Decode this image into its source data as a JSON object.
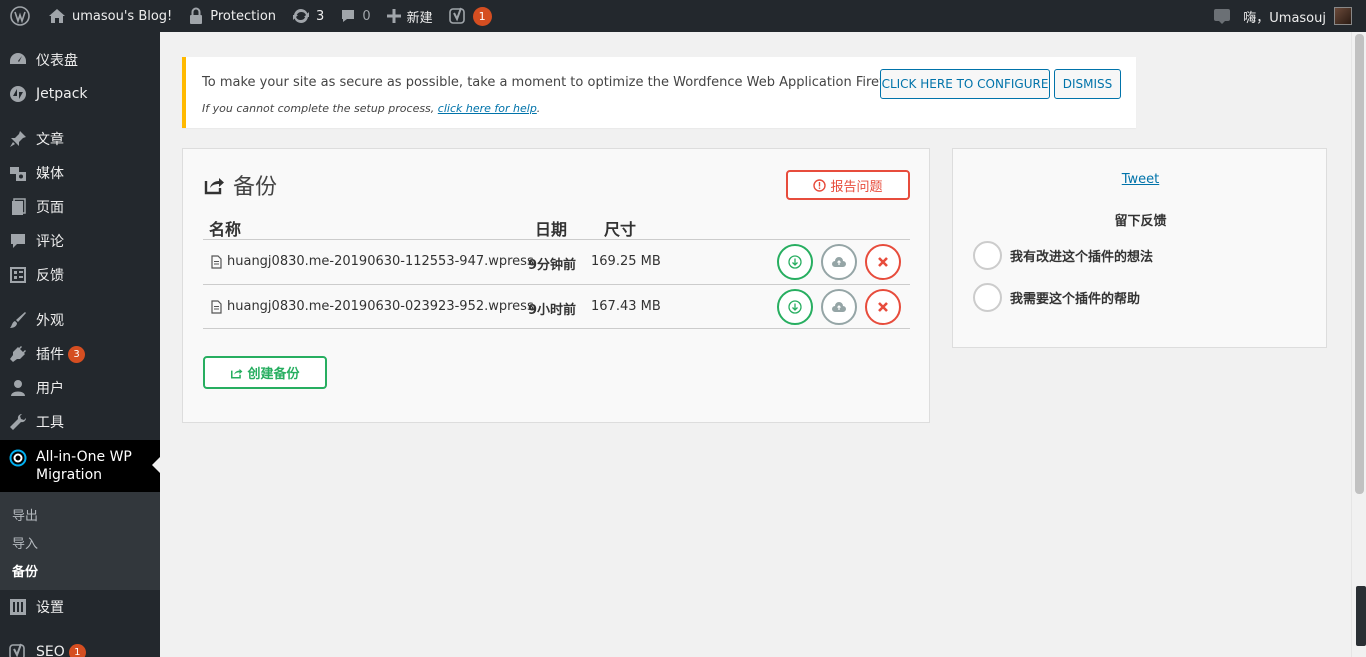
{
  "adminbar": {
    "site_name": "umasou's Blog!",
    "protection": "Protection",
    "updates_count": "3",
    "comments_count": "0",
    "new_label": "新建",
    "yoast_badge": "1",
    "greeting": "嗨，Umasouj"
  },
  "sidebar": {
    "items": [
      {
        "label": "仪表盘",
        "icon": "dashboard-icon"
      },
      {
        "label": "Jetpack",
        "icon": "jetpack-icon"
      },
      {
        "label": "文章",
        "icon": "pin-icon"
      },
      {
        "label": "媒体",
        "icon": "media-icon"
      },
      {
        "label": "页面",
        "icon": "page-icon"
      },
      {
        "label": "评论",
        "icon": "comment-icon"
      },
      {
        "label": "反馈",
        "icon": "feedback-icon"
      },
      {
        "label": "外观",
        "icon": "brush-icon"
      },
      {
        "label": "插件",
        "icon": "plugin-icon",
        "badge": "3"
      },
      {
        "label": "用户",
        "icon": "user-icon"
      },
      {
        "label": "工具",
        "icon": "wrench-icon"
      }
    ],
    "current": {
      "label": "All-in-One WP Migration",
      "icon": "migration-icon"
    },
    "submenu": [
      "导出",
      "导入",
      "备份"
    ],
    "after": [
      {
        "label": "设置",
        "icon": "settings-icon"
      },
      {
        "label": "SEO",
        "icon": "yoast-icon",
        "badge": "1"
      }
    ]
  },
  "notice": {
    "message": "To make your site as secure as possible, take a moment to optimize the Wordfence Web Application Firewall:",
    "configure_button": "CLICK HERE TO CONFIGURE",
    "dismiss_button": "DISMISS",
    "sub_prefix": "If you cannot complete the setup process,",
    "sub_link": "click here for help",
    "sub_suffix": "."
  },
  "backups": {
    "title": "备份",
    "report_button": "报告问题",
    "columns": {
      "name": "名称",
      "date": "日期",
      "size": "尺寸"
    },
    "rows": [
      {
        "name": "huangj0830.me-20190630-112553-947.wpress",
        "date": "9分钟前",
        "size": "169.25 MB"
      },
      {
        "name": "huangj0830.me-20190630-023923-952.wpress",
        "date": "9小时前",
        "size": "167.43 MB"
      }
    ],
    "create_button": "创建备份"
  },
  "feedback": {
    "tweet": "Tweet",
    "title": "留下反馈",
    "options": [
      "我有改进这个插件的想法",
      "我需要这个插件的帮助"
    ]
  },
  "colors": {
    "admin_bg": "#23282d",
    "accent_blue": "#0073aa",
    "badge_orange": "#d54e21",
    "green": "#27ae60",
    "red": "#e74c3c",
    "warning_yellow": "#ffb900"
  }
}
